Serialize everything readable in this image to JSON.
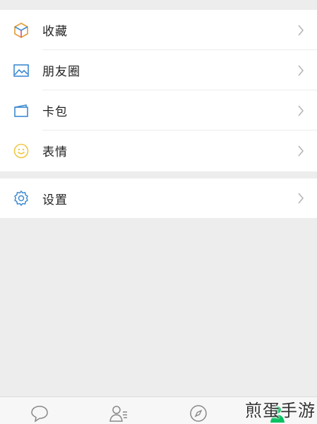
{
  "menu": {
    "items": [
      {
        "label": "收藏",
        "icon": "cube-icon"
      },
      {
        "label": "朋友圈",
        "icon": "picture-icon"
      },
      {
        "label": "卡包",
        "icon": "card-wallet-icon"
      },
      {
        "label": "表情",
        "icon": "smiley-icon"
      }
    ]
  },
  "settings": {
    "label": "设置",
    "icon": "gear-icon"
  },
  "tabbar": {
    "tabs": [
      {
        "icon": "chat-bubble-icon"
      },
      {
        "icon": "contacts-icon"
      },
      {
        "icon": "compass-icon"
      },
      {
        "icon": "me-icon"
      }
    ]
  },
  "watermark": {
    "text": "煎蛋手游"
  },
  "colors": {
    "background": "#ededed",
    "card": "#ffffff",
    "accent_green": "#07c160",
    "icon_blue": "#3d8bd0",
    "icon_yellow": "#f2c744"
  }
}
